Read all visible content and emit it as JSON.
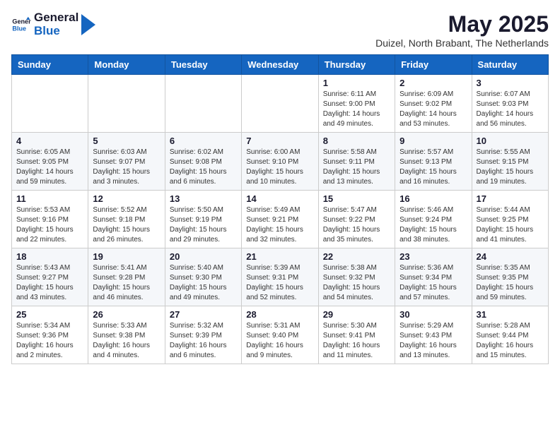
{
  "header": {
    "logo_general": "General",
    "logo_blue": "Blue",
    "month_title": "May 2025",
    "location": "Duizel, North Brabant, The Netherlands"
  },
  "weekdays": [
    "Sunday",
    "Monday",
    "Tuesday",
    "Wednesday",
    "Thursday",
    "Friday",
    "Saturday"
  ],
  "rows": [
    [
      {
        "day": "",
        "info": ""
      },
      {
        "day": "",
        "info": ""
      },
      {
        "day": "",
        "info": ""
      },
      {
        "day": "",
        "info": ""
      },
      {
        "day": "1",
        "info": "Sunrise: 6:11 AM\nSunset: 9:00 PM\nDaylight: 14 hours\nand 49 minutes."
      },
      {
        "day": "2",
        "info": "Sunrise: 6:09 AM\nSunset: 9:02 PM\nDaylight: 14 hours\nand 53 minutes."
      },
      {
        "day": "3",
        "info": "Sunrise: 6:07 AM\nSunset: 9:03 PM\nDaylight: 14 hours\nand 56 minutes."
      }
    ],
    [
      {
        "day": "4",
        "info": "Sunrise: 6:05 AM\nSunset: 9:05 PM\nDaylight: 14 hours\nand 59 minutes."
      },
      {
        "day": "5",
        "info": "Sunrise: 6:03 AM\nSunset: 9:07 PM\nDaylight: 15 hours\nand 3 minutes."
      },
      {
        "day": "6",
        "info": "Sunrise: 6:02 AM\nSunset: 9:08 PM\nDaylight: 15 hours\nand 6 minutes."
      },
      {
        "day": "7",
        "info": "Sunrise: 6:00 AM\nSunset: 9:10 PM\nDaylight: 15 hours\nand 10 minutes."
      },
      {
        "day": "8",
        "info": "Sunrise: 5:58 AM\nSunset: 9:11 PM\nDaylight: 15 hours\nand 13 minutes."
      },
      {
        "day": "9",
        "info": "Sunrise: 5:57 AM\nSunset: 9:13 PM\nDaylight: 15 hours\nand 16 minutes."
      },
      {
        "day": "10",
        "info": "Sunrise: 5:55 AM\nSunset: 9:15 PM\nDaylight: 15 hours\nand 19 minutes."
      }
    ],
    [
      {
        "day": "11",
        "info": "Sunrise: 5:53 AM\nSunset: 9:16 PM\nDaylight: 15 hours\nand 22 minutes."
      },
      {
        "day": "12",
        "info": "Sunrise: 5:52 AM\nSunset: 9:18 PM\nDaylight: 15 hours\nand 26 minutes."
      },
      {
        "day": "13",
        "info": "Sunrise: 5:50 AM\nSunset: 9:19 PM\nDaylight: 15 hours\nand 29 minutes."
      },
      {
        "day": "14",
        "info": "Sunrise: 5:49 AM\nSunset: 9:21 PM\nDaylight: 15 hours\nand 32 minutes."
      },
      {
        "day": "15",
        "info": "Sunrise: 5:47 AM\nSunset: 9:22 PM\nDaylight: 15 hours\nand 35 minutes."
      },
      {
        "day": "16",
        "info": "Sunrise: 5:46 AM\nSunset: 9:24 PM\nDaylight: 15 hours\nand 38 minutes."
      },
      {
        "day": "17",
        "info": "Sunrise: 5:44 AM\nSunset: 9:25 PM\nDaylight: 15 hours\nand 41 minutes."
      }
    ],
    [
      {
        "day": "18",
        "info": "Sunrise: 5:43 AM\nSunset: 9:27 PM\nDaylight: 15 hours\nand 43 minutes."
      },
      {
        "day": "19",
        "info": "Sunrise: 5:41 AM\nSunset: 9:28 PM\nDaylight: 15 hours\nand 46 minutes."
      },
      {
        "day": "20",
        "info": "Sunrise: 5:40 AM\nSunset: 9:30 PM\nDaylight: 15 hours\nand 49 minutes."
      },
      {
        "day": "21",
        "info": "Sunrise: 5:39 AM\nSunset: 9:31 PM\nDaylight: 15 hours\nand 52 minutes."
      },
      {
        "day": "22",
        "info": "Sunrise: 5:38 AM\nSunset: 9:32 PM\nDaylight: 15 hours\nand 54 minutes."
      },
      {
        "day": "23",
        "info": "Sunrise: 5:36 AM\nSunset: 9:34 PM\nDaylight: 15 hours\nand 57 minutes."
      },
      {
        "day": "24",
        "info": "Sunrise: 5:35 AM\nSunset: 9:35 PM\nDaylight: 15 hours\nand 59 minutes."
      }
    ],
    [
      {
        "day": "25",
        "info": "Sunrise: 5:34 AM\nSunset: 9:36 PM\nDaylight: 16 hours\nand 2 minutes."
      },
      {
        "day": "26",
        "info": "Sunrise: 5:33 AM\nSunset: 9:38 PM\nDaylight: 16 hours\nand 4 minutes."
      },
      {
        "day": "27",
        "info": "Sunrise: 5:32 AM\nSunset: 9:39 PM\nDaylight: 16 hours\nand 6 minutes."
      },
      {
        "day": "28",
        "info": "Sunrise: 5:31 AM\nSunset: 9:40 PM\nDaylight: 16 hours\nand 9 minutes."
      },
      {
        "day": "29",
        "info": "Sunrise: 5:30 AM\nSunset: 9:41 PM\nDaylight: 16 hours\nand 11 minutes."
      },
      {
        "day": "30",
        "info": "Sunrise: 5:29 AM\nSunset: 9:43 PM\nDaylight: 16 hours\nand 13 minutes."
      },
      {
        "day": "31",
        "info": "Sunrise: 5:28 AM\nSunset: 9:44 PM\nDaylight: 16 hours\nand 15 minutes."
      }
    ]
  ]
}
